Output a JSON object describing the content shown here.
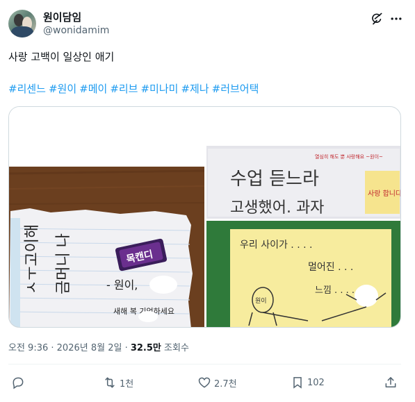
{
  "author": {
    "name": "원이담임",
    "handle": "@wonidamim"
  },
  "tweet": {
    "text": "사랑 고백이 일상인 애기",
    "hashtags": [
      "#리센느",
      "#원이",
      "#메이",
      "#리브",
      "#미나미",
      "#제나",
      "#러브어택"
    ]
  },
  "media": {
    "left_note": {
      "candy_label": "목캔디",
      "name_line": "- 원이,"
    },
    "top_right_note": {
      "header": "열심히 해도 뿐 사랑해요 ~원이~",
      "line1": "수업 듣느라",
      "line2": "고생했어. 과자",
      "sticky": "사랑 합니다"
    },
    "bottom_right_note": {
      "line1": "우리 사이가 . . . .",
      "line2": "멀어진 . . .",
      "line3": "느낌 . . . . .",
      "figure_label": "원이"
    }
  },
  "meta": {
    "time": "오전 9:36",
    "date": "2026년 8월 2일",
    "views_count": "32.5만",
    "views_label": "조회수",
    "separator": " · "
  },
  "actions": {
    "reply_count": "",
    "retweet_count": "1천",
    "like_count": "2.7천",
    "bookmark_count": "102"
  },
  "colors": {
    "accent": "#1d9bf0",
    "text": "#0f1419",
    "secondary": "#536471"
  }
}
